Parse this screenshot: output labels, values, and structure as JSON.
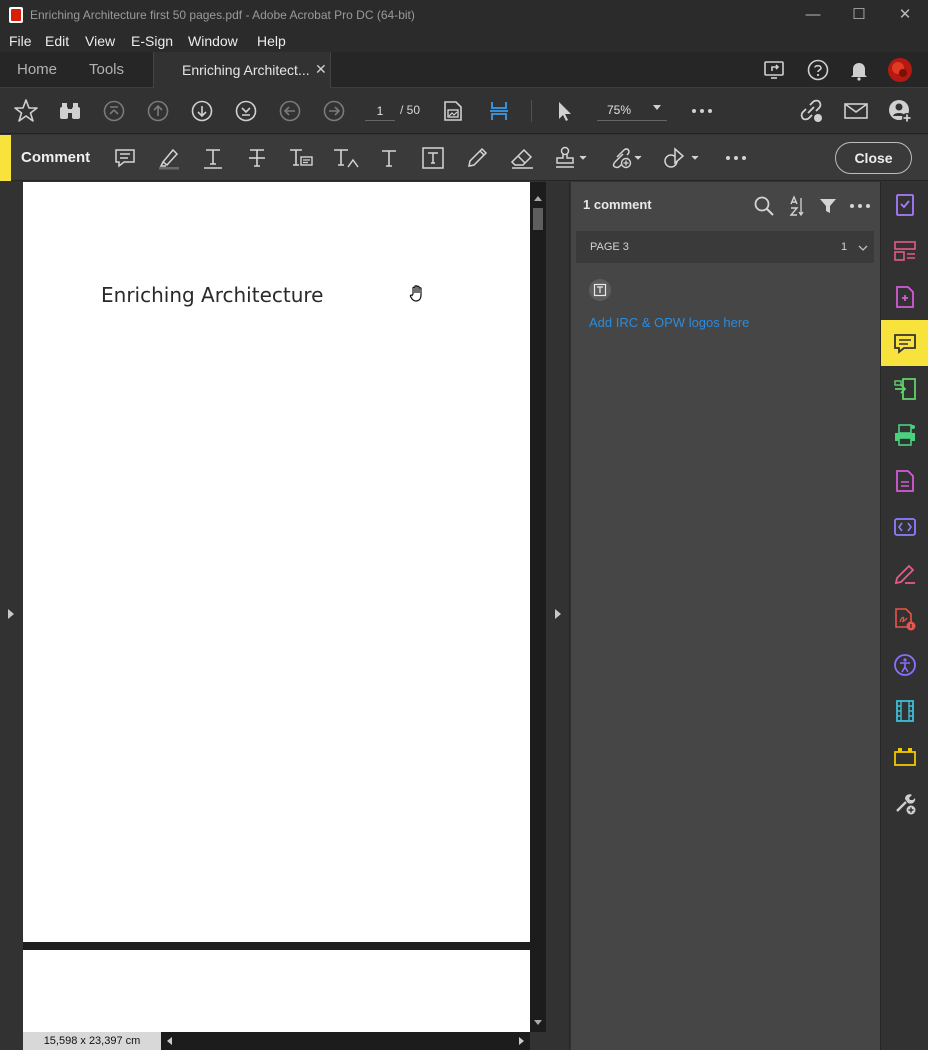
{
  "window": {
    "title": "Enriching Architecture first 50 pages.pdf - Adobe Acrobat Pro DC (64-bit)",
    "minimize": "—",
    "maximize": "☐",
    "close": "✕"
  },
  "menu": [
    "File",
    "Edit",
    "View",
    "E-Sign",
    "Window",
    "Help"
  ],
  "tabs": {
    "home": "Home",
    "tools": "Tools",
    "document": "Enriching Architect...",
    "document_close": "✕"
  },
  "toolbar": {
    "current_page": "1",
    "total_pages": "/ 50",
    "zoom": "75%"
  },
  "comment_toolbar": {
    "label": "Comment",
    "close_label": "Close",
    "accent_color": "#f8e23c"
  },
  "document": {
    "page_title": "Enriching Architecture"
  },
  "status": {
    "page_dimensions": "15,598 x 23,397 cm"
  },
  "comments_panel": {
    "count_label": "1 comment",
    "group_label": "PAGE 3",
    "group_count": "1",
    "comments": [
      {
        "text": "Add IRC & OPW logos here",
        "color": "#2b8cde"
      }
    ]
  },
  "right_rail": {
    "tools": [
      "checklist-icon",
      "organize-pages-icon",
      "create-pdf-icon",
      "comment-icon",
      "export-pdf-icon",
      "print-production-icon",
      "edit-pdf-icon",
      "redact-icon",
      "fill-sign-icon",
      "protect-icon",
      "accessibility-icon",
      "rich-media-icon",
      "action-wizard-icon",
      "more-tools-icon"
    ],
    "active": "comment-icon"
  }
}
